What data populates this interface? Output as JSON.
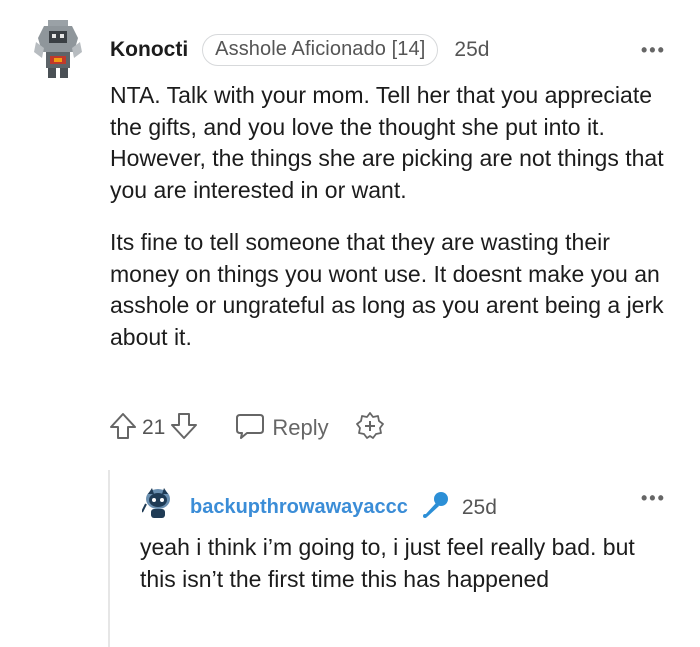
{
  "top_comment": {
    "username": "Konocti",
    "flair": "Asshole Aficionado [14]",
    "age": "25d",
    "more": "•••",
    "paragraphs": [
      "NTA. Talk with your mom. Tell her that you appreciate the gifts, and you love the thought she put into it. However, the things she are picking are not things that you are interested in or want.",
      "Its fine to tell someone that they are wasting their money on things you wont use. It doesnt make you an asshole or ungrateful as long as you arent being a jerk about it."
    ],
    "votes": "21",
    "reply_label": "Reply",
    "avatar_icon": "robot-avatar-icon"
  },
  "reply_comment": {
    "username": "backupthrowawayaccc",
    "age": "25d",
    "more": "•••",
    "text": "yeah i think i’m going to, i just feel really bad. but this isn’t the first time this has happened",
    "badge_icon": "microphone-icon",
    "avatar_icon": "snoo-avatar-icon"
  },
  "colors": {
    "username_reply": "#3b8dd7",
    "text": "#1c1c1c",
    "meta": "#555555"
  }
}
